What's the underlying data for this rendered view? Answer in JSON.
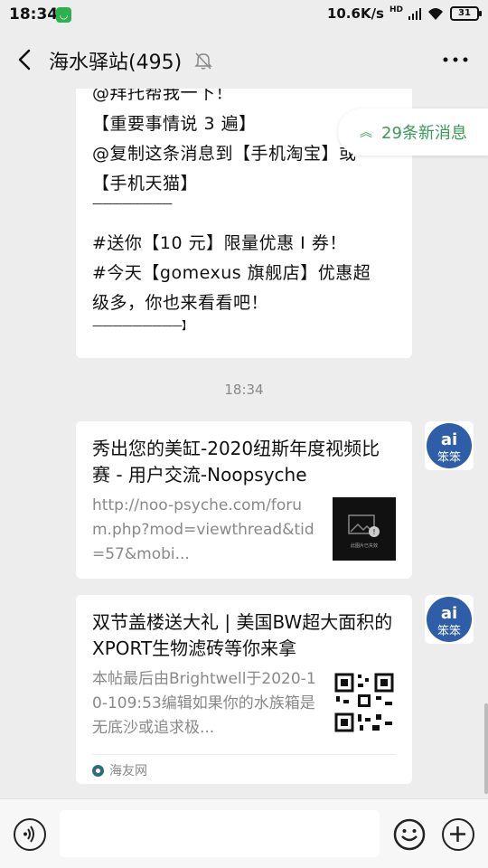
{
  "status_bar": {
    "time": "18:34",
    "network_speed": "10.6K/s",
    "network_type": "HD",
    "battery": "31"
  },
  "header": {
    "title": "海水驿站(495)",
    "back_icon": "chevron-left-icon",
    "mute_icon": "bell-off-icon",
    "more_icon": "more-icon"
  },
  "messages": {
    "text_message": {
      "lines": [
        "@拜托帮我一下！",
        "【重要事情说 3 遍】",
        "@复制这条消息到【手机淘宝】或",
        "【手机天猫】",
        "————————",
        "#送你【10 元】限量优惠 I 券！",
        "#今天【gomexus 旗舰店】优惠超",
        "级多，你也来看看吧！",
        "—————————】"
      ]
    },
    "new_messages": {
      "label": "29条新消息",
      "icon": "double-chevron-up-icon"
    },
    "timestamp": "18:34",
    "cards": [
      {
        "title": "秀出您的美缸-2020纽斯年度视频比赛 - 用户交流-Noopsyche",
        "description": "http://noo-psyche.com/forum.php?mod=viewthread&tid=57&mobi...",
        "thumbnail_caption": "此图片已失效",
        "thumbnail_icon": "broken-image-icon"
      },
      {
        "title": "双节盖楼送大礼 | 美国BW超大面积的XPORT生物滤砖等你来拿",
        "description": "本帖最后由Brightwell于2020-10-109:53编辑如果你的水族箱是无底沙或追求极...",
        "thumbnail_icon": "qr-code-icon",
        "source": "海友网"
      }
    ]
  },
  "input_bar": {
    "voice_icon": "voice-icon",
    "input_value": "",
    "emoji_icon": "emoji-icon",
    "plus_icon": "plus-icon"
  },
  "colors": {
    "accent_green": "#3a9a5b",
    "background": "#ededed",
    "bubble": "#ffffff",
    "muted_text": "#888888"
  }
}
